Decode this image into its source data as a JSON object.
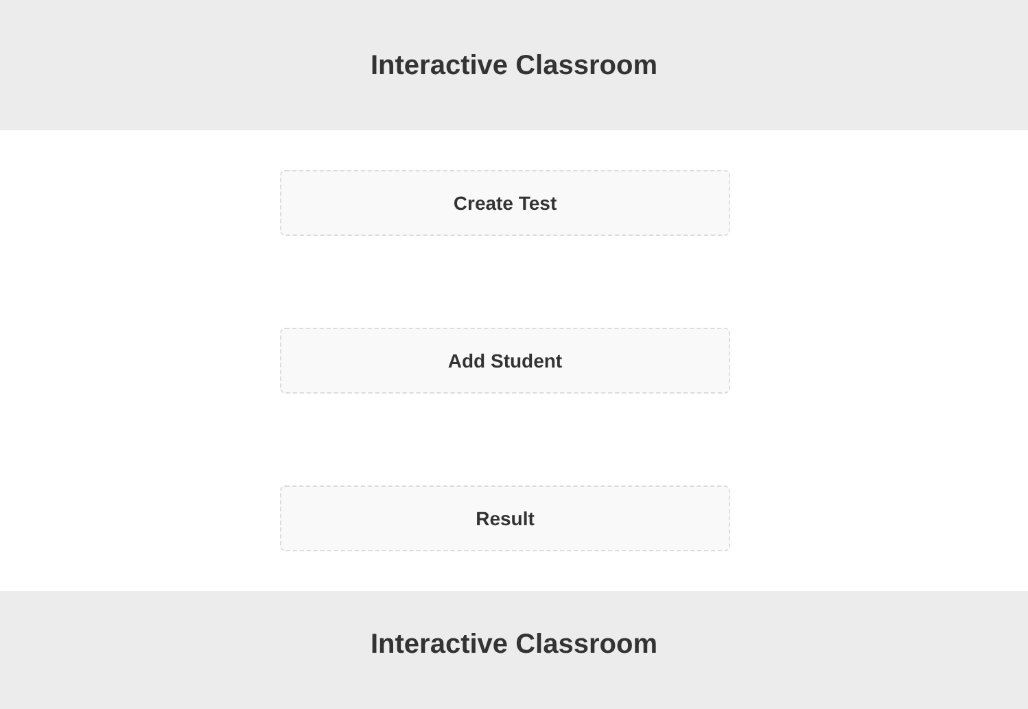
{
  "header": {
    "title": "Interactive Classroom"
  },
  "buttons": [
    {
      "label": "Create Test"
    },
    {
      "label": "Add Student"
    },
    {
      "label": "Result"
    }
  ],
  "footer": {
    "title": "Interactive Classroom"
  }
}
